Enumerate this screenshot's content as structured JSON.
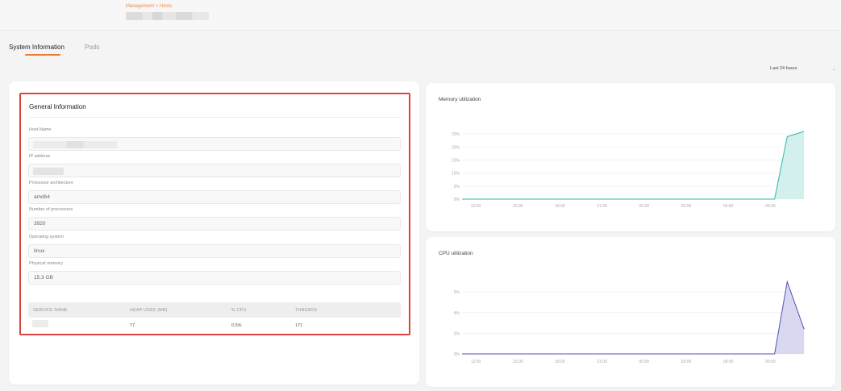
{
  "header": {
    "breadcrumb": [
      "Management",
      "Hosts"
    ],
    "breadcrumb_separator": ">",
    "accent_color": "#f07b2f"
  },
  "tabs": [
    {
      "label": "System Information",
      "active": true
    },
    {
      "label": "Pods",
      "active": false
    }
  ],
  "time_range": {
    "selected": "Last 24 hours"
  },
  "general_info": {
    "title": "General Information",
    "fields": [
      {
        "label": "Host Name",
        "value": ""
      },
      {
        "label": "IP address",
        "value": ""
      },
      {
        "label": "Processor architecture",
        "value": "amd64"
      },
      {
        "label": "Number of processors",
        "value": "3920"
      },
      {
        "label": "Operating system",
        "value": "linux"
      },
      {
        "label": "Physical memory",
        "value": "15.3 GB"
      }
    ],
    "services_table": {
      "columns": [
        "SERVICE NAME",
        "HEAP USED (MB)",
        "% CPU",
        "THREADS"
      ],
      "rows": [
        {
          "name": "",
          "heap": "77",
          "cpu": "0.5%",
          "threads": "171"
        }
      ]
    }
  },
  "chart_data": [
    {
      "type": "area",
      "title": "Memory utilization",
      "x": [
        "12:00",
        "15:00",
        "18:00",
        "21:00",
        "00:00",
        "03:00",
        "06:00",
        "09:00"
      ],
      "y_ticks": [
        "0%",
        "5%",
        "10%",
        "15%",
        "20%",
        "25%"
      ],
      "ylim": [
        0,
        26
      ],
      "series": [
        {
          "color": "#2cb9ad",
          "fill": "#d3f0ee",
          "points": [
            [
              0,
              0
            ],
            [
              7.1,
              0
            ],
            [
              7.4,
              24
            ],
            [
              7.8,
              26
            ]
          ]
        }
      ]
    },
    {
      "type": "area",
      "title": "CPU utilization",
      "x": [
        "12:00",
        "15:00",
        "18:00",
        "21:00",
        "00:00",
        "03:00",
        "06:00",
        "09:00"
      ],
      "y_ticks": [
        "0%",
        "2%",
        "4%",
        "6%"
      ],
      "ylim": [
        0,
        6.8
      ],
      "series": [
        {
          "color": "#5552b5",
          "fill": "#d9d8f1",
          "points": [
            [
              0,
              0
            ],
            [
              7.1,
              0
            ],
            [
              7.4,
              7
            ],
            [
              7.8,
              2.4
            ]
          ]
        }
      ]
    }
  ]
}
